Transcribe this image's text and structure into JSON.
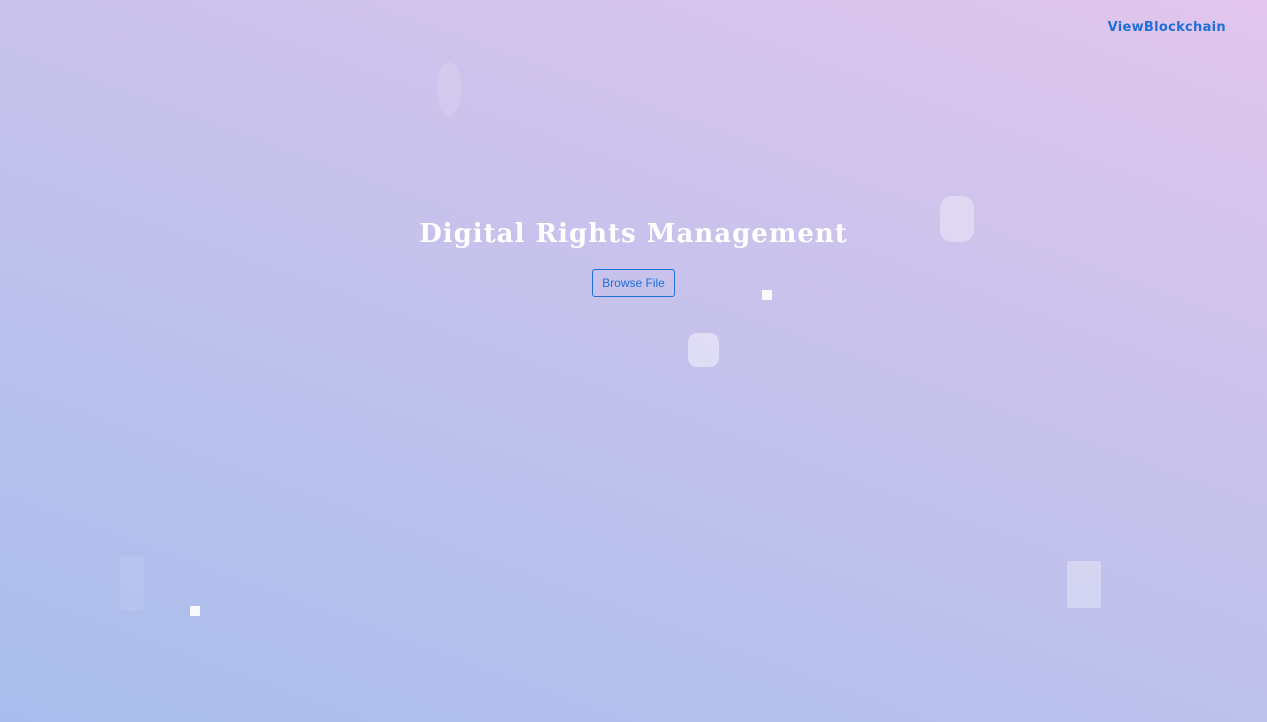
{
  "nav": {
    "link_label": "ViewBlockchain",
    "link_color": "#1f6fd8"
  },
  "hero": {
    "title": "Digital Rights Management",
    "browse_button_label": "Browse File"
  },
  "theme": {
    "background_gradient": [
      "#a9bdec",
      "#e2c5ec"
    ],
    "title_color": "#ffffff",
    "accent": "#1f6fd8"
  }
}
